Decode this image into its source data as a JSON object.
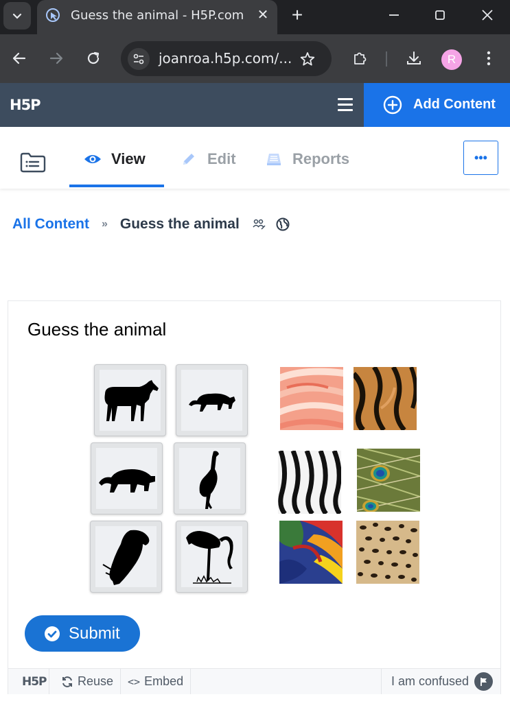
{
  "browser": {
    "tab_title": "Guess the animal - H5P.com",
    "tab_close": "✕",
    "new_tab": "+",
    "url": "joanroa.h5p.com/...",
    "profile_initial": "R"
  },
  "header": {
    "logo": "H5P",
    "add_content": "Add Content"
  },
  "tabs": {
    "view": "View",
    "edit": "Edit",
    "reports": "Reports",
    "more": "•••"
  },
  "breadcrumb": {
    "root": "All Content",
    "sep": "»",
    "current": "Guess the animal"
  },
  "content": {
    "title": "Guess the animal",
    "draggables": [
      {
        "name": "horse"
      },
      {
        "name": "panther"
      },
      {
        "name": "tiger"
      },
      {
        "name": "peacock"
      },
      {
        "name": "parrot"
      },
      {
        "name": "flamingo"
      }
    ],
    "dropzones": [
      {
        "texture": "flamingo-feathers"
      },
      {
        "texture": "tiger-fur"
      },
      {
        "texture": "zebra-stripes"
      },
      {
        "texture": "peacock-feathers"
      },
      {
        "texture": "parrot-feathers"
      },
      {
        "texture": "leopard-spots"
      }
    ],
    "submit": "Submit"
  },
  "footer": {
    "logo": "H5P",
    "reuse": "Reuse",
    "embed": "Embed",
    "embed_glyph": "<>",
    "confused": "I am confused"
  },
  "colors": {
    "accent": "#1a73e8",
    "header": "#3d4c5e",
    "submit": "#1a73d4"
  }
}
